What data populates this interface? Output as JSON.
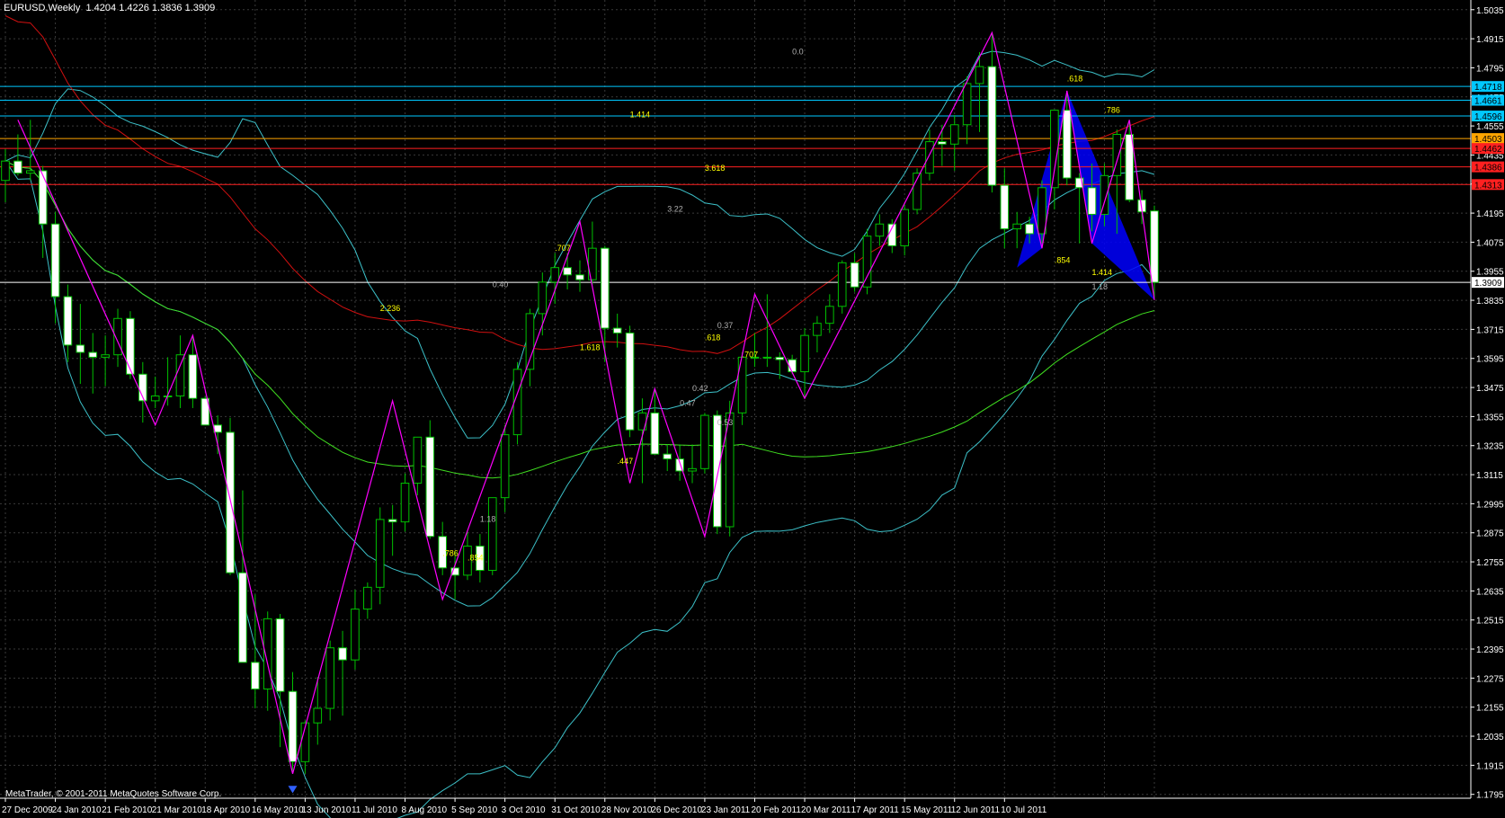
{
  "header": {
    "symbol_timeframe": "EURUSD,Weekly",
    "ohlc": "1.4204 1.4226 1.3836 1.3909"
  },
  "copyright": "MetaTrader, © 2001-2011 MetaQuotes Software Corp.",
  "colors": {
    "background": "#000000",
    "grid": "#3a3a3a",
    "bull_wick": "#00c000",
    "bear_fill": "#ffffff",
    "zigzag": "#ff00ff",
    "bands": "#3cc0c8",
    "ma_red": "#d01010",
    "ma_green": "#40e020",
    "pattern": "#0000ff",
    "fib_text": "#ffff00",
    "fib_text_gray": "#b0b0b0",
    "axis_text": "#ffffff"
  },
  "chart_data": {
    "type": "candlestick",
    "y_axis": {
      "min": 1.1779,
      "max": 1.5075,
      "ticks": [
        "1.5035",
        "1.4915",
        "1.4795",
        "1.4675",
        "1.4555",
        "1.4435",
        "1.4315",
        "1.4195",
        "1.4075",
        "1.3955",
        "1.3835",
        "1.3715",
        "1.3595",
        "1.3475",
        "1.3355",
        "1.3235",
        "1.3115",
        "1.2995",
        "1.2875",
        "1.2755",
        "1.2635",
        "1.2515",
        "1.2395",
        "1.2275",
        "1.2155",
        "1.2035",
        "1.1915",
        "1.1795"
      ]
    },
    "x_axis": {
      "labels": [
        "27 Dec 2009",
        "24 Jan 2010",
        "21 Feb 2010",
        "21 Mar 2010",
        "18 Apr 2010",
        "16 May 2010",
        "13 Jun 2010",
        "11 Jul 2010",
        "8 Aug 2010",
        "5 Sep 2010",
        "3 Oct 2010",
        "31 Oct 2010",
        "28 Nov 2010",
        "26 Dec 2010",
        "23 Jan 2011",
        "20 Feb 2011",
        "20 Mar 2011",
        "17 Apr 2011",
        "15 May 2011",
        "12 Jun 2011",
        "10 Jul 2011"
      ]
    },
    "candles": [
      {
        "o": 1.433,
        "h": 1.446,
        "l": 1.424,
        "c": 1.441
      },
      {
        "o": 1.441,
        "h": 1.452,
        "l": 1.435,
        "c": 1.436
      },
      {
        "o": 1.436,
        "h": 1.458,
        "l": 1.433,
        "c": 1.437
      },
      {
        "o": 1.437,
        "h": 1.439,
        "l": 1.401,
        "c": 1.415
      },
      {
        "o": 1.415,
        "h": 1.42,
        "l": 1.374,
        "c": 1.385
      },
      {
        "o": 1.385,
        "h": 1.39,
        "l": 1.358,
        "c": 1.365
      },
      {
        "o": 1.365,
        "h": 1.382,
        "l": 1.349,
        "c": 1.362
      },
      {
        "o": 1.362,
        "h": 1.37,
        "l": 1.345,
        "c": 1.36
      },
      {
        "o": 1.36,
        "h": 1.369,
        "l": 1.348,
        "c": 1.361
      },
      {
        "o": 1.361,
        "h": 1.38,
        "l": 1.356,
        "c": 1.376
      },
      {
        "o": 1.376,
        "h": 1.379,
        "l": 1.351,
        "c": 1.353
      },
      {
        "o": 1.353,
        "h": 1.358,
        "l": 1.333,
        "c": 1.342
      },
      {
        "o": 1.342,
        "h": 1.352,
        "l": 1.339,
        "c": 1.344
      },
      {
        "o": 1.344,
        "h": 1.36,
        "l": 1.34,
        "c": 1.344
      },
      {
        "o": 1.344,
        "h": 1.369,
        "l": 1.339,
        "c": 1.361
      },
      {
        "o": 1.361,
        "h": 1.369,
        "l": 1.339,
        "c": 1.343
      },
      {
        "o": 1.343,
        "h": 1.344,
        "l": 1.332,
        "c": 1.332
      },
      {
        "o": 1.332,
        "h": 1.336,
        "l": 1.32,
        "c": 1.329
      },
      {
        "o": 1.329,
        "h": 1.335,
        "l": 1.27,
        "c": 1.271
      },
      {
        "o": 1.271,
        "h": 1.305,
        "l": 1.262,
        "c": 1.234
      },
      {
        "o": 1.234,
        "h": 1.262,
        "l": 1.215,
        "c": 1.223
      },
      {
        "o": 1.223,
        "h": 1.255,
        "l": 1.214,
        "c": 1.252
      },
      {
        "o": 1.252,
        "h": 1.254,
        "l": 1.199,
        "c": 1.222
      },
      {
        "o": 1.222,
        "h": 1.23,
        "l": 1.188,
        "c": 1.193
      },
      {
        "o": 1.193,
        "h": 1.21,
        "l": 1.188,
        "c": 1.209
      },
      {
        "o": 1.209,
        "h": 1.228,
        "l": 1.2,
        "c": 1.215
      },
      {
        "o": 1.215,
        "h": 1.243,
        "l": 1.21,
        "c": 1.24
      },
      {
        "o": 1.24,
        "h": 1.247,
        "l": 1.212,
        "c": 1.235
      },
      {
        "o": 1.235,
        "h": 1.264,
        "l": 1.231,
        "c": 1.256
      },
      {
        "o": 1.256,
        "h": 1.267,
        "l": 1.252,
        "c": 1.265
      },
      {
        "o": 1.265,
        "h": 1.298,
        "l": 1.258,
        "c": 1.293
      },
      {
        "o": 1.293,
        "h": 1.299,
        "l": 1.278,
        "c": 1.292
      },
      {
        "o": 1.292,
        "h": 1.312,
        "l": 1.288,
        "c": 1.308
      },
      {
        "o": 1.308,
        "h": 1.327,
        "l": 1.303,
        "c": 1.327
      },
      {
        "o": 1.327,
        "h": 1.334,
        "l": 1.285,
        "c": 1.286
      },
      {
        "o": 1.286,
        "h": 1.292,
        "l": 1.27,
        "c": 1.273
      },
      {
        "o": 1.273,
        "h": 1.28,
        "l": 1.26,
        "c": 1.27
      },
      {
        "o": 1.27,
        "h": 1.288,
        "l": 1.268,
        "c": 1.282
      },
      {
        "o": 1.282,
        "h": 1.287,
        "l": 1.267,
        "c": 1.272
      },
      {
        "o": 1.272,
        "h": 1.302,
        "l": 1.27,
        "c": 1.302
      },
      {
        "o": 1.302,
        "h": 1.332,
        "l": 1.296,
        "c": 1.328
      },
      {
        "o": 1.328,
        "h": 1.358,
        "l": 1.324,
        "c": 1.355
      },
      {
        "o": 1.355,
        "h": 1.38,
        "l": 1.348,
        "c": 1.378
      },
      {
        "o": 1.378,
        "h": 1.395,
        "l": 1.369,
        "c": 1.391
      },
      {
        "o": 1.391,
        "h": 1.403,
        "l": 1.382,
        "c": 1.397
      },
      {
        "o": 1.397,
        "h": 1.403,
        "l": 1.388,
        "c": 1.394
      },
      {
        "o": 1.394,
        "h": 1.4,
        "l": 1.387,
        "c": 1.392
      },
      {
        "o": 1.392,
        "h": 1.416,
        "l": 1.39,
        "c": 1.405
      },
      {
        "o": 1.405,
        "h": 1.406,
        "l": 1.358,
        "c": 1.372
      },
      {
        "o": 1.372,
        "h": 1.378,
        "l": 1.364,
        "c": 1.37
      },
      {
        "o": 1.37,
        "h": 1.373,
        "l": 1.327,
        "c": 1.33
      },
      {
        "o": 1.33,
        "h": 1.343,
        "l": 1.308,
        "c": 1.337
      },
      {
        "o": 1.337,
        "h": 1.347,
        "l": 1.32,
        "c": 1.32
      },
      {
        "o": 1.32,
        "h": 1.324,
        "l": 1.313,
        "c": 1.318
      },
      {
        "o": 1.318,
        "h": 1.324,
        "l": 1.309,
        "c": 1.313
      },
      {
        "o": 1.313,
        "h": 1.324,
        "l": 1.308,
        "c": 1.314
      },
      {
        "o": 1.314,
        "h": 1.337,
        "l": 1.312,
        "c": 1.336
      },
      {
        "o": 1.336,
        "h": 1.338,
        "l": 1.287,
        "c": 1.29
      },
      {
        "o": 1.29,
        "h": 1.342,
        "l": 1.286,
        "c": 1.337
      },
      {
        "o": 1.337,
        "h": 1.362,
        "l": 1.332,
        "c": 1.36
      },
      {
        "o": 1.36,
        "h": 1.37,
        "l": 1.356,
        "c": 1.36
      },
      {
        "o": 1.36,
        "h": 1.386,
        "l": 1.356,
        "c": 1.36
      },
      {
        "o": 1.36,
        "h": 1.362,
        "l": 1.351,
        "c": 1.359
      },
      {
        "o": 1.359,
        "h": 1.361,
        "l": 1.353,
        "c": 1.354
      },
      {
        "o": 1.354,
        "h": 1.372,
        "l": 1.343,
        "c": 1.369
      },
      {
        "o": 1.369,
        "h": 1.377,
        "l": 1.362,
        "c": 1.374
      },
      {
        "o": 1.374,
        "h": 1.386,
        "l": 1.37,
        "c": 1.381
      },
      {
        "o": 1.381,
        "h": 1.4,
        "l": 1.378,
        "c": 1.399
      },
      {
        "o": 1.399,
        "h": 1.403,
        "l": 1.387,
        "c": 1.389
      },
      {
        "o": 1.389,
        "h": 1.413,
        "l": 1.386,
        "c": 1.41
      },
      {
        "o": 1.41,
        "h": 1.419,
        "l": 1.406,
        "c": 1.415
      },
      {
        "o": 1.415,
        "h": 1.417,
        "l": 1.403,
        "c": 1.406
      },
      {
        "o": 1.406,
        "h": 1.423,
        "l": 1.402,
        "c": 1.421
      },
      {
        "o": 1.421,
        "h": 1.438,
        "l": 1.419,
        "c": 1.436
      },
      {
        "o": 1.436,
        "h": 1.454,
        "l": 1.433,
        "c": 1.449
      },
      {
        "o": 1.449,
        "h": 1.456,
        "l": 1.439,
        "c": 1.448
      },
      {
        "o": 1.448,
        "h": 1.46,
        "l": 1.437,
        "c": 1.456
      },
      {
        "o": 1.456,
        "h": 1.476,
        "l": 1.448,
        "c": 1.473
      },
      {
        "o": 1.473,
        "h": 1.486,
        "l": 1.453,
        "c": 1.48
      },
      {
        "o": 1.48,
        "h": 1.494,
        "l": 1.428,
        "c": 1.431
      },
      {
        "o": 1.431,
        "h": 1.438,
        "l": 1.405,
        "c": 1.413
      },
      {
        "o": 1.413,
        "h": 1.42,
        "l": 1.405,
        "c": 1.415
      },
      {
        "o": 1.415,
        "h": 1.418,
        "l": 1.407,
        "c": 1.411
      },
      {
        "o": 1.411,
        "h": 1.433,
        "l": 1.407,
        "c": 1.43
      },
      {
        "o": 1.43,
        "h": 1.462,
        "l": 1.421,
        "c": 1.462
      },
      {
        "o": 1.462,
        "h": 1.47,
        "l": 1.431,
        "c": 1.434
      },
      {
        "o": 1.434,
        "h": 1.436,
        "l": 1.407,
        "c": 1.43
      },
      {
        "o": 1.43,
        "h": 1.44,
        "l": 1.412,
        "c": 1.419
      },
      {
        "o": 1.419,
        "h": 1.44,
        "l": 1.414,
        "c": 1.435
      },
      {
        "o": 1.435,
        "h": 1.454,
        "l": 1.411,
        "c": 1.452
      },
      {
        "o": 1.452,
        "h": 1.458,
        "l": 1.424,
        "c": 1.425
      },
      {
        "o": 1.425,
        "h": 1.429,
        "l": 1.415,
        "c": 1.42
      },
      {
        "o": 1.4204,
        "h": 1.4226,
        "l": 1.3836,
        "c": 1.3909
      }
    ],
    "zigzag": [
      [
        1,
        1.458
      ],
      [
        12,
        1.332
      ],
      [
        15,
        1.369
      ],
      [
        23,
        1.188
      ],
      [
        31,
        1.342
      ],
      [
        35,
        1.26
      ],
      [
        46,
        1.416
      ],
      [
        50,
        1.308
      ],
      [
        52,
        1.347
      ],
      [
        56,
        1.286
      ],
      [
        60,
        1.386
      ],
      [
        64,
        1.343
      ],
      [
        79,
        1.494
      ],
      [
        83,
        1.405
      ],
      [
        85,
        1.47
      ],
      [
        87,
        1.407
      ],
      [
        90,
        1.458
      ],
      [
        92,
        1.3836
      ]
    ],
    "price_levels": [
      {
        "label": "1.4718",
        "value": 1.4718,
        "color": "#00c8ff",
        "text": "#000000"
      },
      {
        "label": "1.4661",
        "value": 1.4661,
        "color": "#00c8ff",
        "text": "#000000"
      },
      {
        "label": "1.4596",
        "value": 1.4596,
        "color": "#00c8ff",
        "text": "#000000"
      },
      {
        "label": "1.4503",
        "value": 1.4503,
        "color": "#ffa500",
        "text": "#000000"
      },
      {
        "label": "1.4462",
        "value": 1.4462,
        "color": "#ff2020",
        "text": "#000000"
      },
      {
        "label": "1.4386",
        "value": 1.4386,
        "color": "#ff2020",
        "text": "#000000"
      },
      {
        "label": "1.4313",
        "value": 1.4313,
        "color": "#ff2020",
        "text": "#000000"
      },
      {
        "label": "1.3909",
        "value": 1.3909,
        "color": "#ffffff",
        "text": "#000000"
      }
    ],
    "annotations": [
      {
        "text": ".618",
        "i": 85,
        "v": 1.474,
        "color": "#ffff00"
      },
      {
        "text": ".786",
        "i": 88,
        "v": 1.461,
        "color": "#ffff00"
      },
      {
        "text": "1.414",
        "i": 50,
        "v": 1.459,
        "color": "#ffff00"
      },
      {
        "text": "3.618",
        "i": 56,
        "v": 1.437,
        "color": "#ffff00"
      },
      {
        "text": "3.22",
        "i": 53,
        "v": 1.42,
        "color": "#b0b0b0"
      },
      {
        "text": ".707",
        "i": 44,
        "v": 1.404,
        "color": "#ffff00"
      },
      {
        "text": ".854",
        "i": 84,
        "v": 1.399,
        "color": "#ffff00"
      },
      {
        "text": "1.414",
        "i": 87,
        "v": 1.394,
        "color": "#ffff00"
      },
      {
        "text": "1.18",
        "i": 87,
        "v": 1.388,
        "color": "#b0b0b0"
      },
      {
        "text": "0.40",
        "i": 39,
        "v": 1.389,
        "color": "#b0b0b0"
      },
      {
        "text": "2.236",
        "i": 30,
        "v": 1.379,
        "color": "#ffff00"
      },
      {
        "text": "0.37",
        "i": 57,
        "v": 1.372,
        "color": "#b0b0b0"
      },
      {
        "text": ".618",
        "i": 56,
        "v": 1.367,
        "color": "#ffff00"
      },
      {
        "text": "1.618",
        "i": 46,
        "v": 1.363,
        "color": "#ffff00"
      },
      {
        "text": ".707",
        "i": 59,
        "v": 1.36,
        "color": "#ffff00"
      },
      {
        "text": "0.42",
        "i": 55,
        "v": 1.346,
        "color": "#b0b0b0"
      },
      {
        "text": "0.47",
        "i": 54,
        "v": 1.34,
        "color": "#b0b0b0"
      },
      {
        "text": "0.53",
        "i": 57,
        "v": 1.332,
        "color": "#b0b0b0"
      },
      {
        "text": ".447",
        "i": 49,
        "v": 1.316,
        "color": "#ffff00"
      },
      {
        "text": "1.18",
        "i": 38,
        "v": 1.292,
        "color": "#b0b0b0"
      },
      {
        "text": ".786",
        "i": 35,
        "v": 1.278,
        "color": "#ffff00"
      },
      {
        "text": ".854",
        "i": 37,
        "v": 1.276,
        "color": "#ffff00"
      },
      {
        "text": "0.0",
        "i": 63,
        "v": 1.485,
        "color": "#b0b0b0"
      }
    ],
    "grid": true
  }
}
